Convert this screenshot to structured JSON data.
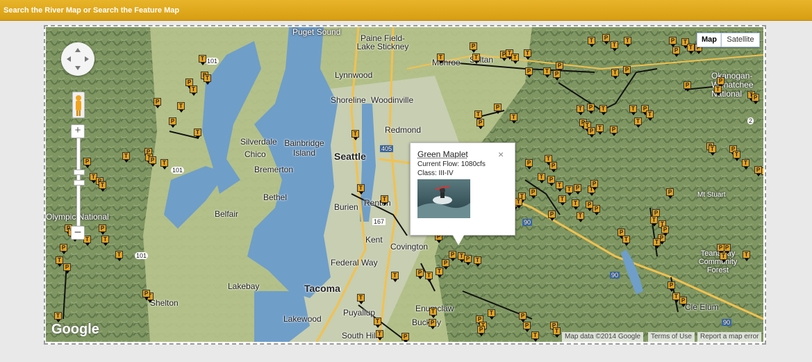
{
  "header": {
    "title": "Search the River Map or Search the Feature Map"
  },
  "map_type": {
    "map_label": "Map",
    "satellite_label": "Satellite"
  },
  "attribution": {
    "data": "Map data ©2014 Google",
    "terms": "Terms of Use",
    "report": "Report a map error"
  },
  "logo": "Google",
  "place_labels": [
    "Puget Sound",
    "Paine Field-Lake Stickney",
    "Lynnwood",
    "Monroe",
    "Sultan",
    "Shoreline",
    "Woodinville",
    "Redmond",
    "Silverdale",
    "Bainbridge Island",
    "Chico",
    "Bremerton",
    "Seattle",
    "Bethel",
    "Belfair",
    "Burien",
    "Renton",
    "Kent",
    "Covington",
    "Federal Way",
    "Lakebay",
    "Tacoma",
    "Lakewood",
    "Puyallup",
    "South Hill",
    "Enumclaw",
    "Buckley",
    "Shelton",
    "Olympic National",
    "Okanogan-Wenatchee National",
    "Teanaway Community Forest",
    "Cle Elum",
    "Mt Stuart"
  ],
  "road_labels": [
    "101",
    "101",
    "101",
    "405",
    "167",
    "90",
    "90",
    "90",
    "2"
  ],
  "popup": {
    "title": "Green Maplet",
    "flow": "Current Flow: 1080cfs",
    "class": "Class: III-IV",
    "close": "×"
  },
  "marker_letters": {
    "put_in": "P",
    "take_out": "T"
  },
  "colors": {
    "header": "#e0a81c",
    "marker": "#e4a21e",
    "water": "#6f9ec9"
  }
}
